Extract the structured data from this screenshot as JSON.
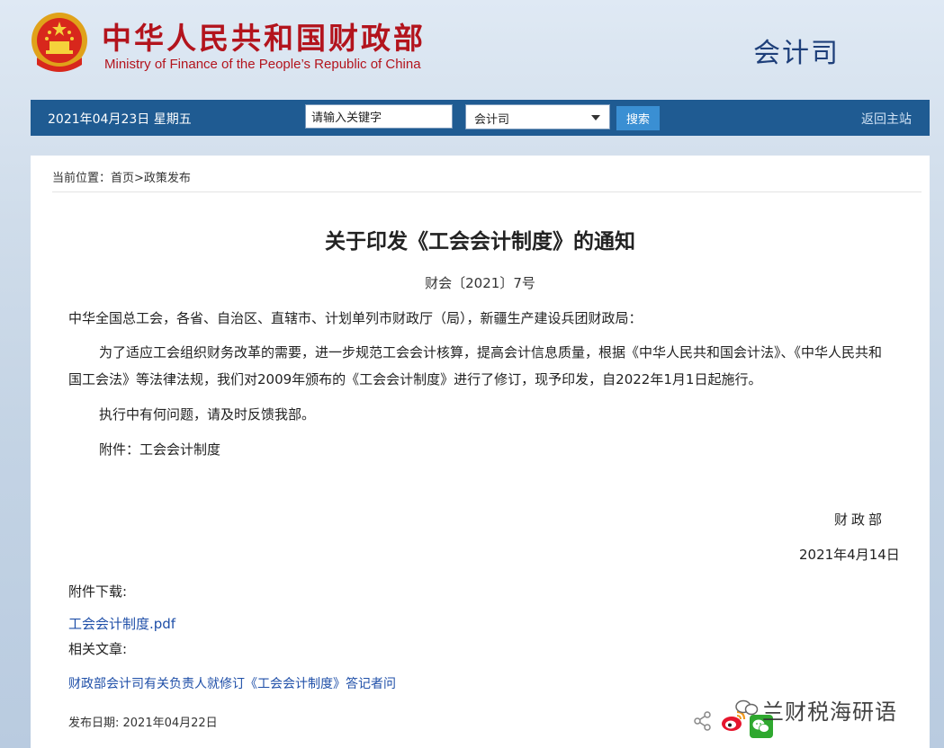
{
  "header": {
    "title_cn": "中华人民共和国财政部",
    "title_en": "Ministry of Finance of the People’s Republic of China",
    "department": "会计司"
  },
  "nav": {
    "date": "2021年04月23日  星期五",
    "search_value": "请输入关键字",
    "select_value": "会计司",
    "search_button": "搜索",
    "home_link": "返回主站"
  },
  "breadcrumb": "当前位置：首页>政策发布",
  "article": {
    "title": "关于印发《工会会计制度》的通知",
    "doc_no": "财会〔2021〕7号",
    "para1": "中华全国总工会，各省、自治区、直辖市、计划单列市财政厅（局），新疆生产建设兵团财政局：",
    "para2": "为了适应工会组织财务改革的需要，进一步规范工会会计核算，提高会计信息质量，根据《中华人民共和国会计法》、《中华人民共和国工会法》等法律法规，我们对2009年颁布的《工会会计制度》进行了修订，现予印发，自2022年1月1日起施行。",
    "para3": "执行中有何问题，请及时反馈我部。",
    "para4": "附件：工会会计制度",
    "signer": "财政部",
    "sign_date": "2021年4月14日"
  },
  "attachments": {
    "label": "附件下载:",
    "file": "工会会计制度.pdf"
  },
  "related": {
    "label": "相关文章:",
    "link": "财政部会计司有关负责人就修订《工会会计制度》答记者问"
  },
  "publish_date": "发布日期:  2021年04月22日",
  "watermark": "兰财税海研语",
  "colors": {
    "nav_bg": "#1f5b92",
    "title_red": "#b3141d",
    "link_blue": "#1f4fa8"
  },
  "icons": [
    "national-emblem-icon",
    "share-icon",
    "weibo-icon",
    "wechat-icon",
    "dropdown-arrow-icon"
  ]
}
